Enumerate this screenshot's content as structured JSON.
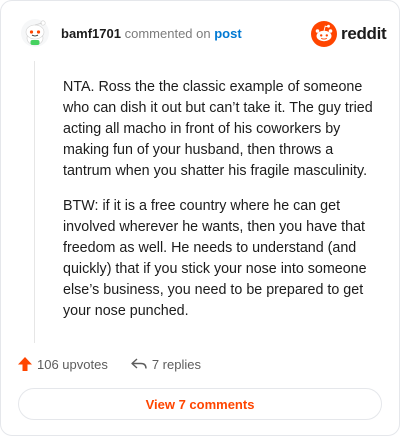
{
  "header": {
    "username": "bamf1701",
    "action_text": "commented on",
    "post_link": "post",
    "logo_text": "reddit"
  },
  "comment": {
    "paragraphs": [
      "NTA. Ross the the classic example of someone who can dish it out but can’t take it. The guy tried acting all macho in front of his coworkers by making fun of your husband, then throws a tantrum when you shatter his fragile masculinity.",
      "BTW: if it is a free country where he can get involved wherever he wants, then you have that freedom as well. He needs to understand (and quickly) that if you stick your nose into someone else’s business, you need to be prepared to get your nose punched."
    ]
  },
  "footer": {
    "upvotes": "106 upvotes",
    "replies": "7 replies",
    "view_button": "View 7 comments"
  },
  "icons": {
    "avatar": "snoo-avatar-icon",
    "logo": "reddit-snoo-icon",
    "upvote": "upvote-arrow-icon",
    "reply": "reply-arrow-icon"
  },
  "colors": {
    "accent": "#ff4500",
    "link": "#0079d3",
    "text": "#1c1c1c",
    "muted": "#7c7c7c"
  }
}
